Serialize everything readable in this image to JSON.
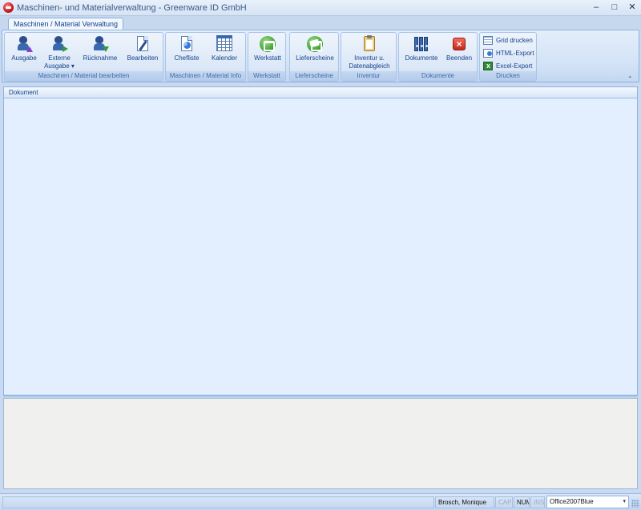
{
  "window": {
    "title": "Maschinen- und Materialverwaltung - Greenware ID GmbH",
    "min_glyph": "–",
    "max_glyph": "□",
    "close_glyph": "✕"
  },
  "tabs": [
    {
      "label": "Maschinen / Material Verwaltung",
      "active": true
    }
  ],
  "ribbon": {
    "groups": [
      {
        "label": "Maschinen / Material  bearbeiten",
        "buttons": [
          {
            "label": "Ausgabe",
            "icon": "person-arrow-up-icon"
          },
          {
            "label": "Externe",
            "label2": "Ausgabe ▾",
            "icon": "person-external-icon"
          },
          {
            "label": "Rücknahme",
            "icon": "person-arrow-down-icon"
          },
          {
            "label": "Bearbeiten",
            "icon": "edit-document-icon"
          }
        ]
      },
      {
        "label": "Maschinen / Material  Info",
        "buttons": [
          {
            "label": "Chefliste",
            "icon": "report-chart-icon"
          },
          {
            "label": "Kalender",
            "icon": "calendar-icon"
          }
        ]
      },
      {
        "label": "Werkstatt",
        "buttons": [
          {
            "label": "Werkstatt",
            "icon": "workshop-icon"
          }
        ]
      },
      {
        "label": "Lieferscheine",
        "buttons": [
          {
            "label": "Lieferscheine",
            "icon": "delivery-note-icon"
          }
        ]
      },
      {
        "label": "Inventur",
        "buttons": [
          {
            "label": "Inventur  u.",
            "label2": "Datenabgleich",
            "icon": "clipboard-icon"
          }
        ]
      },
      {
        "label": "Dokumente",
        "buttons": [
          {
            "label": "Dokumente",
            "icon": "binders-icon"
          },
          {
            "label": "Beenden",
            "icon": "exit-icon"
          }
        ]
      },
      {
        "label": "Drucken",
        "small_buttons": [
          {
            "label": "Grid drucken",
            "icon": "grid-print-icon"
          },
          {
            "label": "HTML-Export",
            "icon": "html-export-icon"
          },
          {
            "label": "Excel-Export",
            "icon": "excel-export-icon"
          }
        ]
      }
    ],
    "collapse_glyph": "⌃"
  },
  "document_panel": {
    "header": "Dokument"
  },
  "statusbar": {
    "main_text": "",
    "user": "Brosch, Monique",
    "caps": "CAPS",
    "num": "NUM",
    "ins": "INS",
    "theme": "Office2007Blue",
    "theme_dropdown_glyph": "▾"
  },
  "colors": {
    "accent": "#15428b",
    "ribbon_border": "#8db2e3",
    "panel_bg": "#e3efff"
  }
}
